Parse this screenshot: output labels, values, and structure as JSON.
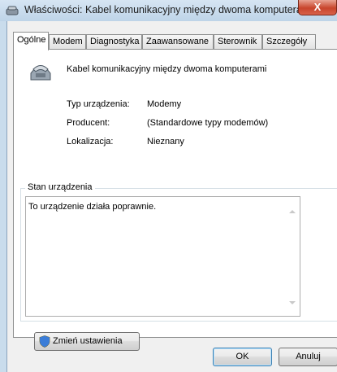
{
  "window": {
    "title": "Właściwości: Kabel komunikacyjny między dwoma komputerami",
    "close_glyph": "X"
  },
  "tabs": [
    {
      "label": "Ogólne",
      "active": true
    },
    {
      "label": "Modem",
      "active": false
    },
    {
      "label": "Diagnostyka",
      "active": false
    },
    {
      "label": "Zaawansowane",
      "active": false
    },
    {
      "label": "Sterownik",
      "active": false
    },
    {
      "label": "Szczegóły",
      "active": false
    }
  ],
  "device": {
    "name": "Kabel komunikacyjny między dwoma komputerami",
    "icon": "modem-phone-icon"
  },
  "properties": [
    {
      "label": "Typ urządzenia:",
      "value": "Modemy"
    },
    {
      "label": "Producent:",
      "value": "(Standardowe typy modemów)"
    },
    {
      "label": "Lokalizacja:",
      "value": "Nieznany"
    }
  ],
  "status": {
    "group_label": "Stan urządzenia",
    "text": "To urządzenie działa poprawnie."
  },
  "buttons": {
    "change_settings": "Zmień ustawienia",
    "change_settings_icon": "uac-shield-icon",
    "ok": "OK",
    "cancel": "Anuluj"
  },
  "colors": {
    "frame": "#c9dcec",
    "close_button": "#c8452c",
    "ok_border": "#3c7fb1"
  }
}
